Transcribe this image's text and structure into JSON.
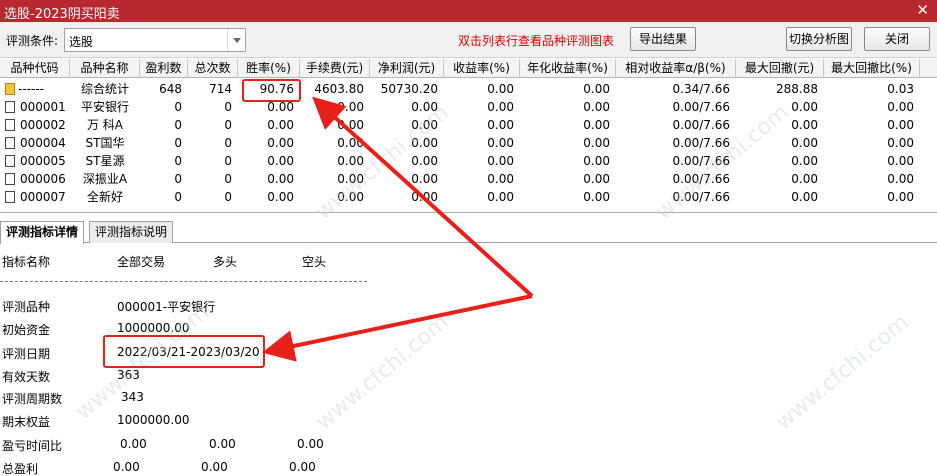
{
  "window": {
    "title": "选股-2023阴买阳卖",
    "close_glyph": "✕"
  },
  "toolbar": {
    "condition_label": "评测条件:",
    "condition_value": "选股",
    "hint": "双击列表行查看品种评测图表",
    "export_label": "导出结果",
    "switch_label": "切换分析图",
    "close_label": "关闭"
  },
  "table": {
    "headers": [
      "品种代码",
      "品种名称",
      "盈利数",
      "总次数",
      "胜率(%)",
      "手续费(元)",
      "净利润(元)",
      "收益率(%)",
      "年化收益率(%)",
      "相对收益率α/β(%)",
      "最大回撤(元)",
      "最大回撤比(%)"
    ],
    "rows": [
      [
        "------",
        "综合统计",
        "648",
        "714",
        "90.76",
        "4603.80",
        "50730.20",
        "0.00",
        "0.00",
        "0.34/7.66",
        "288.88",
        "0.03"
      ],
      [
        "000001",
        "平安银行",
        "0",
        "0",
        "0.00",
        "0.00",
        "0.00",
        "0.00",
        "0.00",
        "0.00/7.66",
        "0.00",
        "0.00"
      ],
      [
        "000002",
        "万 科A",
        "0",
        "0",
        "0.00",
        "0.00",
        "0.00",
        "0.00",
        "0.00",
        "0.00/7.66",
        "0.00",
        "0.00"
      ],
      [
        "000004",
        "ST国华",
        "0",
        "0",
        "0.00",
        "0.00",
        "0.00",
        "0.00",
        "0.00",
        "0.00/7.66",
        "0.00",
        "0.00"
      ],
      [
        "000005",
        "ST星源",
        "0",
        "0",
        "0.00",
        "0.00",
        "0.00",
        "0.00",
        "0.00",
        "0.00/7.66",
        "0.00",
        "0.00"
      ],
      [
        "000006",
        "深振业A",
        "0",
        "0",
        "0.00",
        "0.00",
        "0.00",
        "0.00",
        "0.00",
        "0.00/7.66",
        "0.00",
        "0.00"
      ],
      [
        "000007",
        "全新好",
        "0",
        "0",
        "0.00",
        "0.00",
        "0.00",
        "0.00",
        "0.00",
        "0.00/7.66",
        "0.00",
        "0.00"
      ]
    ]
  },
  "tabs": [
    "评测指标详情",
    "评测指标说明"
  ],
  "detail": {
    "col_header": "指标名称",
    "col_all": "全部交易",
    "col_long": "多头",
    "col_short": "空头",
    "product_label": "评测品种",
    "product_value": "000001-平安银行",
    "capital_label": "初始资金",
    "capital_value": "1000000.00",
    "date_label": "评测日期",
    "date_value": "2022/03/21-2023/03/20",
    "days_label": "有效天数",
    "days_value": "363",
    "period_label": "评测周期数",
    "period_value": "343",
    "equity_label": "期末权益",
    "equity_value": "1000000.00",
    "ratio_label": "盈亏时间比",
    "ratio_all": "0.00",
    "ratio_long": "0.00",
    "ratio_short": "0.00",
    "profit_label": "总盈利",
    "profit_all": "0.00",
    "profit_long": "0.00",
    "profit_short": "0.00"
  },
  "watermark": "www.cfchi.com",
  "colors": {
    "titlebar": "#b8282f",
    "annotation": "#e8201a",
    "hint": "#d40000"
  }
}
